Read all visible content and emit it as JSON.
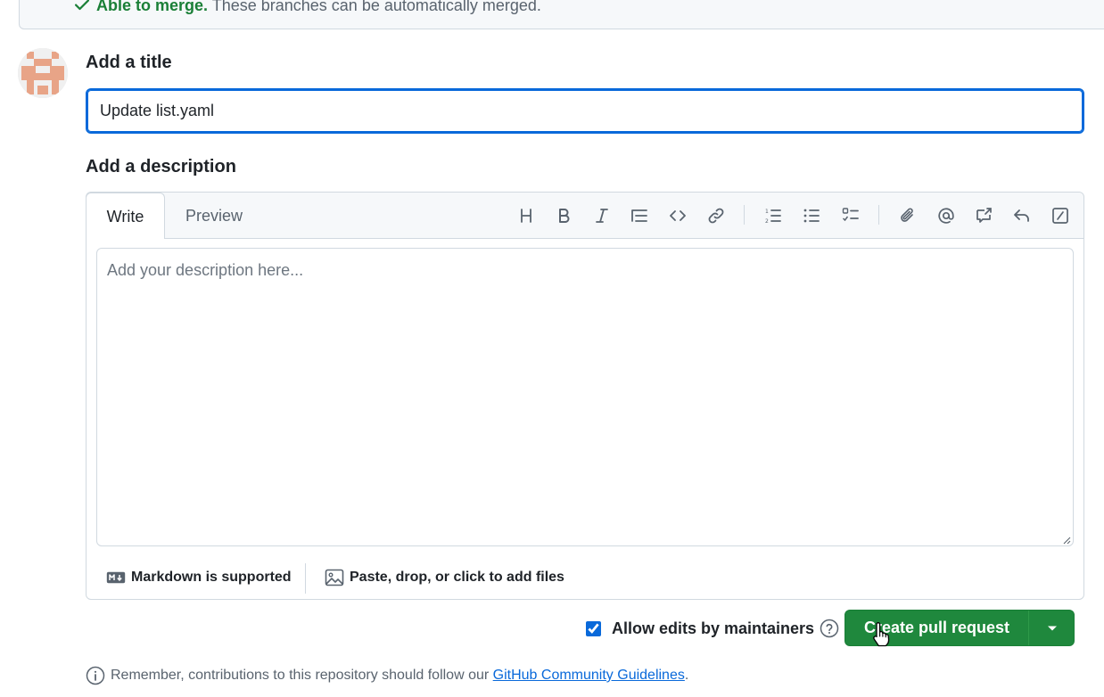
{
  "merge_status": {
    "title": "Able to merge.",
    "message": "These branches can be automatically merged."
  },
  "form": {
    "title_label": "Add a title",
    "title_value": "Update list.yaml",
    "description_label": "Add a description"
  },
  "editor": {
    "tabs": [
      {
        "label": "Write",
        "active": true
      },
      {
        "label": "Preview",
        "active": false
      }
    ],
    "toolbar_icons": [
      "heading-icon",
      "bold-icon",
      "italic-icon",
      "quote-icon",
      "code-icon",
      "link-icon",
      "ordered-list-icon",
      "unordered-list-icon",
      "task-list-icon",
      "attach-icon",
      "mention-icon",
      "cross-reference-icon",
      "reply-icon",
      "slash-commands-icon"
    ],
    "placeholder": "Add your description here...",
    "markdown_note": "Markdown is supported",
    "files_note": "Paste, drop, or click to add files"
  },
  "actions": {
    "allow_edits_label": "Allow edits by maintainers",
    "allow_edits_checked": true,
    "create_label": "Create pull request"
  },
  "footer": {
    "remember_text": "Remember, contributions to this repository should follow our",
    "guidelines_link": "GitHub Community Guidelines",
    "period": "."
  },
  "colors": {
    "primary_button": "#1f883d",
    "focus_border": "#0969da",
    "success_text": "#1a7f37",
    "link": "#0969da",
    "avatar": "#e8a487"
  }
}
